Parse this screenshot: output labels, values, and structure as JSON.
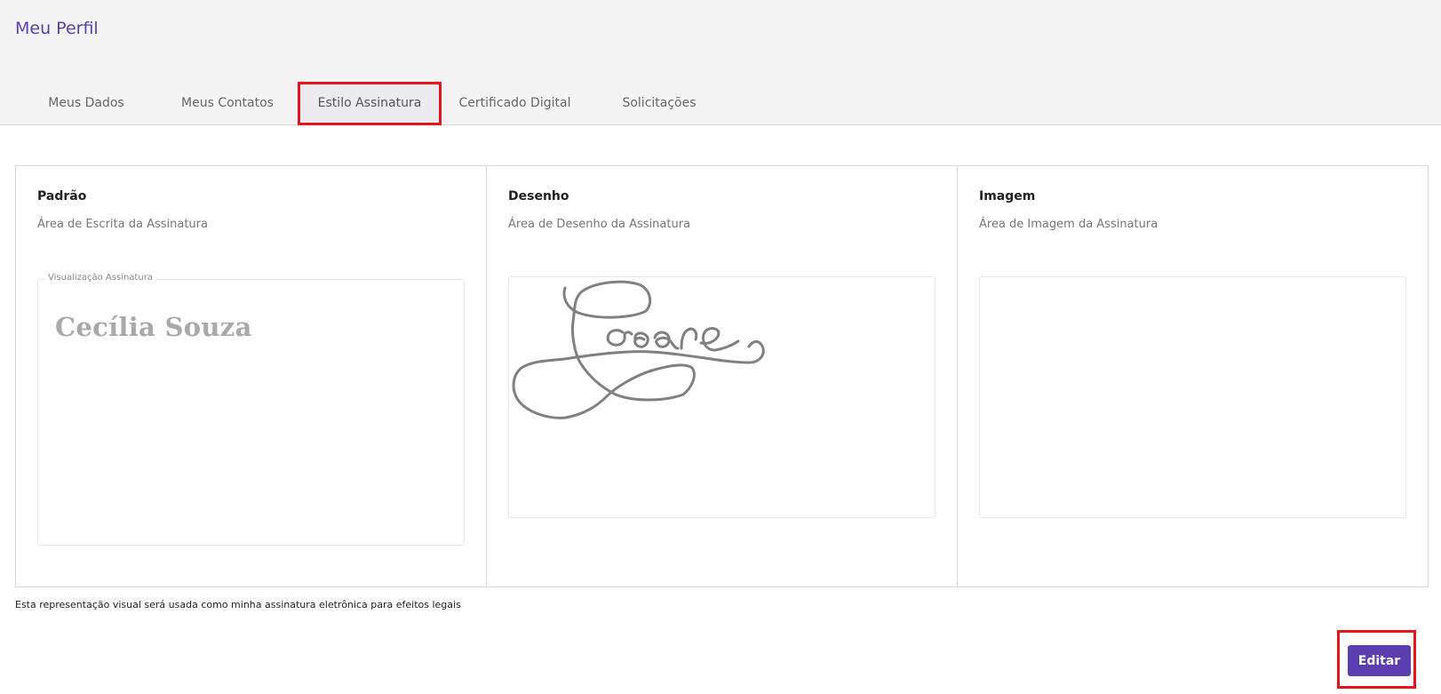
{
  "page": {
    "title": "Meu Perfil"
  },
  "tabs": [
    {
      "label": "Meus Dados",
      "active": false
    },
    {
      "label": "Meus Contatos",
      "active": false
    },
    {
      "label": "Estilo Assinatura",
      "active": true
    },
    {
      "label": "Certificado Digital",
      "active": false
    },
    {
      "label": "Solicitações",
      "active": false
    }
  ],
  "panels": {
    "standard": {
      "title": "Padrão",
      "subtitle": "Área de Escrita da Assinatura",
      "preview_legend": "Visualização Assinatura",
      "signature_text": "Cecília Souza"
    },
    "drawing": {
      "title": "Desenho",
      "subtitle": "Área de Desenho da Assinatura"
    },
    "image": {
      "title": "Imagem",
      "subtitle": "Área de Imagem da Assinatura"
    }
  },
  "footnote": "Esta representação visual será usada como minha assinatura eletrônica para efeitos legais",
  "actions": {
    "edit_label": "Editar"
  },
  "colors": {
    "accent": "#5b3fb0",
    "highlight": "#e8141c",
    "signature_stroke": "#808080"
  }
}
